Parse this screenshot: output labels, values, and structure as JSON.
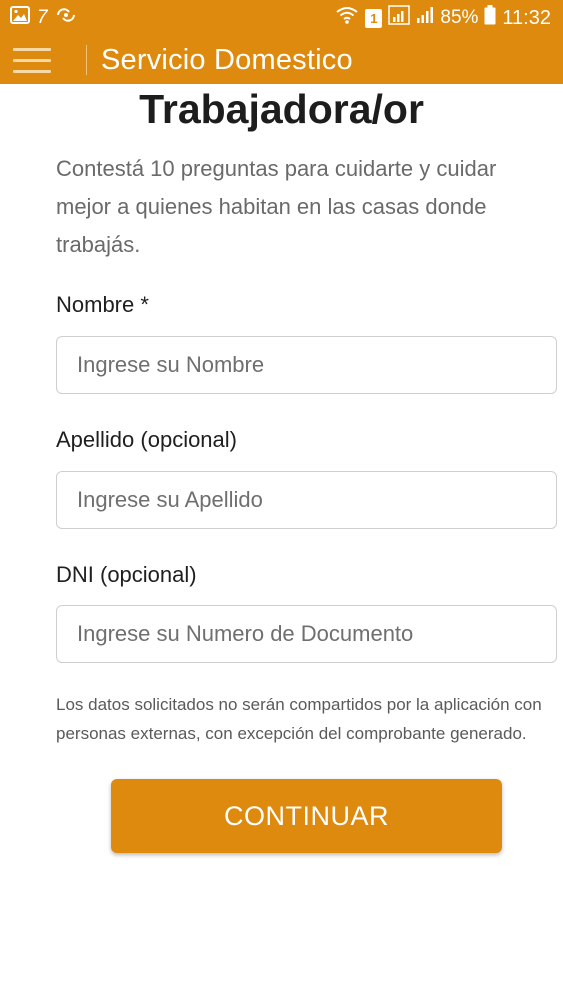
{
  "status_bar": {
    "notification_count": "7",
    "battery_percent": "85%",
    "time": "11:32",
    "sim_slot": "1"
  },
  "app_bar": {
    "title": "Servicio Domestico"
  },
  "form": {
    "heading": "Trabajadora/or",
    "intro": "Contestá 10 preguntas para cuidarte y cuidar mejor a quienes habitan en las casas donde trabajás.",
    "fields": [
      {
        "label": "Nombre *",
        "placeholder": "Ingrese su Nombre",
        "value": ""
      },
      {
        "label": "Apellido (opcional)",
        "placeholder": "Ingrese su Apellido",
        "value": ""
      },
      {
        "label": "DNI (opcional)",
        "placeholder": "Ingrese su Numero de Documento",
        "value": ""
      }
    ],
    "privacy_notice": "Los datos solicitados no serán compartidos por la aplicación con personas externas, con excepción del comprobante generado.",
    "continue_label": "CONTINUAR"
  },
  "colors": {
    "primary": "#de8a0e",
    "on_primary": "#ffffff"
  }
}
